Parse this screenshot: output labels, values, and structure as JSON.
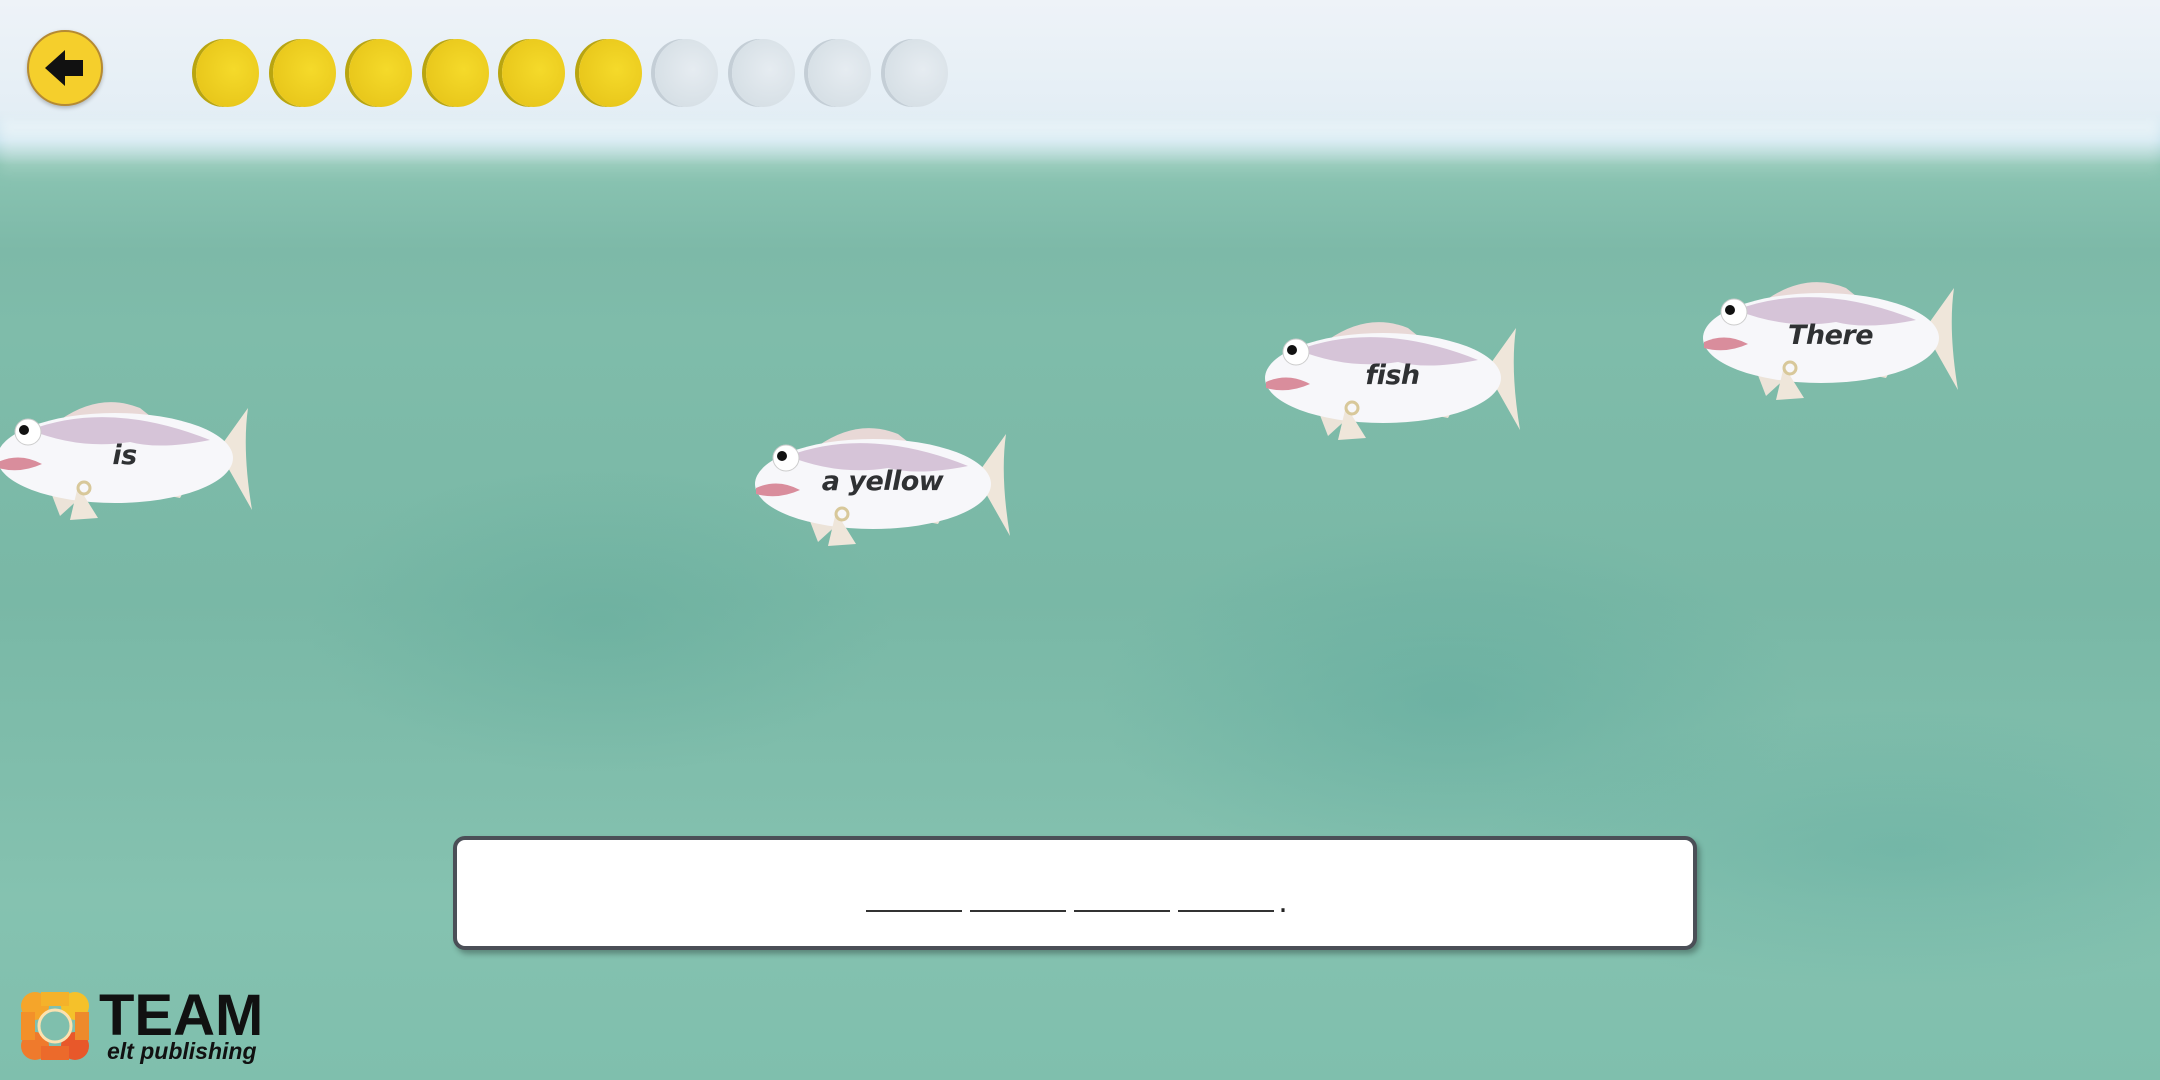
{
  "header": {
    "back_icon": "arrow-left-icon",
    "coins_total": 10,
    "coins_earned": 6,
    "colors": {
      "coin_earned": "#f0d024",
      "coin_empty": "#dde5eb"
    }
  },
  "fish": [
    {
      "word": "is"
    },
    {
      "word": "a yellow"
    },
    {
      "word": "fish"
    },
    {
      "word": "There"
    }
  ],
  "answer": {
    "blanks": 4,
    "punctuation": "."
  },
  "logo": {
    "title": "TEAM",
    "subtitle": "elt publishing"
  }
}
